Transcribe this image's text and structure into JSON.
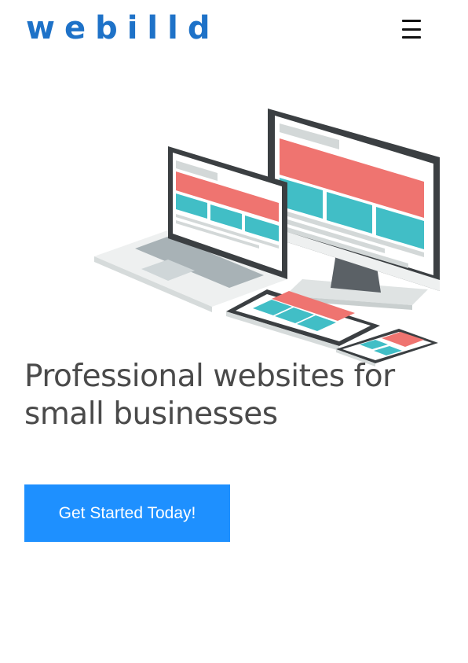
{
  "header": {
    "logo_text": "webilld",
    "menu_icon": "hamburger-menu-icon"
  },
  "hero": {
    "illustration": "responsive-devices-illustration",
    "headline": "Professional websites for small businesses",
    "cta_label": "Get Started Today!"
  },
  "colors": {
    "brand_blue": "#1e72c8",
    "cta_blue": "#1e90ff",
    "headline_gray": "#4a4a4a",
    "accent_red": "#ef7470",
    "accent_teal": "#41bec6",
    "device_dark": "#3b3f42",
    "device_light": "#eef0f0"
  }
}
